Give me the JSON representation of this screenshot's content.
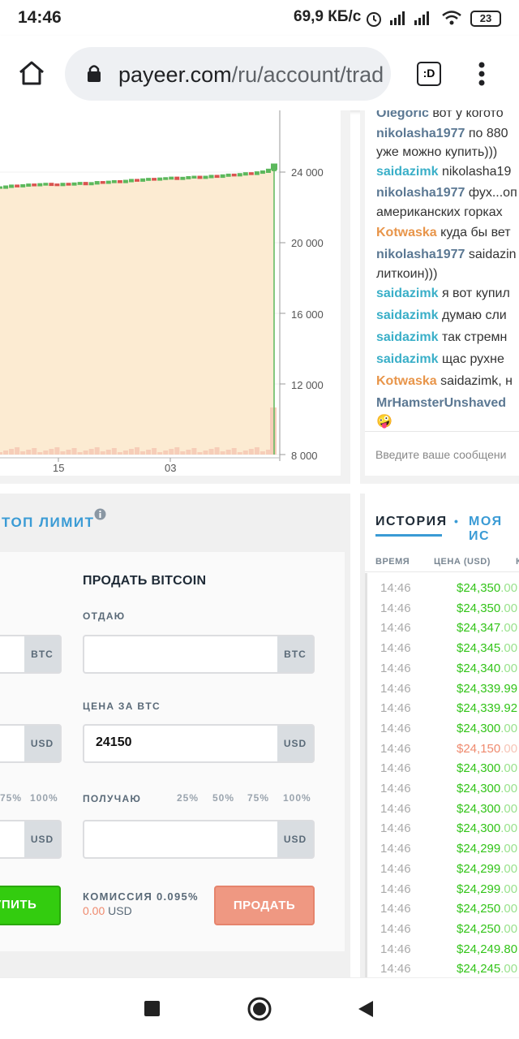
{
  "status": {
    "time": "14:46",
    "speed": "69,9 КБ/с",
    "battery": "23"
  },
  "browser": {
    "url_host": "payeer.com",
    "url_path": "/ru/account/trad",
    "tabs_label": ":D"
  },
  "chart": {
    "y_ticks": [
      "24 000",
      "20 000",
      "16 000",
      "12 000",
      "8 000"
    ],
    "x_ticks": [
      "15",
      "03"
    ]
  },
  "chart_data": {
    "type": "candlestick",
    "title": "",
    "xlabel": "",
    "ylabel": "",
    "y_ticks": [
      24000,
      20000,
      16000,
      12000,
      8000
    ],
    "x_tick_labels": [
      "15",
      "03"
    ],
    "series": [
      {
        "name": "",
        "values": [
          23100,
          23150,
          23200,
          23180,
          23220,
          23260,
          23240,
          23280,
          23300,
          23260,
          23250,
          23300,
          23280,
          23320,
          23350,
          23300,
          23340,
          23400,
          23380,
          23420,
          23450,
          23420,
          23470,
          23520,
          23500,
          23550,
          23580,
          23560,
          23600,
          23620,
          23650,
          23600,
          23640,
          23680,
          23700,
          23660,
          23700,
          23750,
          23720,
          23780,
          23820,
          23800,
          23850,
          23900,
          23880,
          23950,
          24000,
          24100,
          24300
        ]
      }
    ],
    "ylim": [
      8000,
      24500
    ],
    "area_fill": "#fcebd2",
    "last_line_color": "#5cb85c"
  },
  "chat": {
    "messages": [
      {
        "user": "Olegoric",
        "text": "вот у когото",
        "color": "#5b7893"
      },
      {
        "user": "nikolasha1977",
        "text": "по 880",
        "color": "#5b7893"
      },
      {
        "user": "",
        "text": "уже можно купить)))",
        "color": "#333"
      },
      {
        "user": "saidazimk",
        "text": "nikolasha19",
        "color": "#3aafc8"
      },
      {
        "user": "nikolasha1977",
        "text": "фух...оп",
        "color": "#5b7893"
      },
      {
        "user": "",
        "text": "американских горках",
        "color": "#333"
      },
      {
        "user": "Kotwaska",
        "text": "куда бы вет",
        "color": "#e8954a"
      },
      {
        "user": "nikolasha1977",
        "text": "saidazin",
        "color": "#5b7893"
      },
      {
        "user": "",
        "text": "литкоин)))",
        "color": "#333"
      },
      {
        "user": "saidazimk",
        "text": "я вот купил",
        "color": "#3aafc8"
      },
      {
        "user": "saidazimk",
        "text": "думаю сли",
        "color": "#3aafc8"
      },
      {
        "user": "saidazimk",
        "text": "так стремн",
        "color": "#3aafc8"
      },
      {
        "user": "saidazimk",
        "text": "щас рухне",
        "color": "#3aafc8"
      },
      {
        "user": "Kotwaska",
        "text": "saidazimk, н",
        "color": "#e8954a"
      },
      {
        "user": "MrHamsterUnshaved",
        "text": "",
        "color": "#5b7893"
      },
      {
        "user": "",
        "text": "🤪",
        "color": "#333"
      }
    ],
    "input_placeholder": "Введите ваше сообщени"
  },
  "trade": {
    "tab_label": "ТОП ЛИМИТ",
    "sell_title": "ПРОДАТЬ BITCOIN",
    "give_label": "ОТДАЮ",
    "price_label": "ЦЕНА ЗА BTC",
    "receive_label": "ПОЛУЧАЮ",
    "btc_suffix": "BTC",
    "usd_suffix": "USD",
    "price_value": "24150",
    "left_pcts": [
      "75%",
      "100%"
    ],
    "right_pcts": [
      "25%",
      "50%",
      "75%",
      "100%"
    ],
    "commission_label": "КОМИССИЯ 0.095%",
    "commission_amount": "0.00",
    "commission_currency": "USD",
    "buy_button": "УПИТЬ",
    "sell_button": "ПРОДАТЬ"
  },
  "history": {
    "tab_history": "ИСТОРИЯ",
    "tab_mine": "МОЯ ИС",
    "col_time": "ВРЕМЯ",
    "col_price": "ЦЕНА (USD)",
    "col_qty": "К",
    "rows": [
      {
        "time": "14:46",
        "price": "$24,350",
        "cents": ".00",
        "dir": "up"
      },
      {
        "time": "14:46",
        "price": "$24,350",
        "cents": ".00",
        "dir": "up"
      },
      {
        "time": "14:46",
        "price": "$24,347",
        "cents": ".00",
        "dir": "up"
      },
      {
        "time": "14:46",
        "price": "$24,345",
        "cents": ".00",
        "dir": "up"
      },
      {
        "time": "14:46",
        "price": "$24,340",
        "cents": ".00",
        "dir": "up"
      },
      {
        "time": "14:46",
        "price": "$24,339.99",
        "cents": "",
        "dir": "up"
      },
      {
        "time": "14:46",
        "price": "$24,339.92",
        "cents": "",
        "dir": "up"
      },
      {
        "time": "14:46",
        "price": "$24,300",
        "cents": ".00",
        "dir": "up"
      },
      {
        "time": "14:46",
        "price": "$24,150",
        "cents": ".00",
        "dir": "down"
      },
      {
        "time": "14:46",
        "price": "$24,300",
        "cents": ".00",
        "dir": "up"
      },
      {
        "time": "14:46",
        "price": "$24,300",
        "cents": ".00",
        "dir": "up"
      },
      {
        "time": "14:46",
        "price": "$24,300",
        "cents": ".00",
        "dir": "up"
      },
      {
        "time": "14:46",
        "price": "$24,300",
        "cents": ".00",
        "dir": "up"
      },
      {
        "time": "14:46",
        "price": "$24,299",
        "cents": ".00",
        "dir": "up"
      },
      {
        "time": "14:46",
        "price": "$24,299",
        "cents": ".00",
        "dir": "up"
      },
      {
        "time": "14:46",
        "price": "$24,299",
        "cents": ".00",
        "dir": "up"
      },
      {
        "time": "14:46",
        "price": "$24,250",
        "cents": ".00",
        "dir": "up"
      },
      {
        "time": "14:46",
        "price": "$24,250",
        "cents": ".00",
        "dir": "up"
      },
      {
        "time": "14:46",
        "price": "$24,249.80",
        "cents": "",
        "dir": "up"
      },
      {
        "time": "14:46",
        "price": "$24,245",
        "cents": ".00",
        "dir": "up"
      }
    ]
  },
  "colors": {
    "up": "#33c419",
    "down": "#ef8a6e",
    "accent": "#3a9bd5",
    "buy": "#33cc0f",
    "sell": "#ef9882"
  }
}
